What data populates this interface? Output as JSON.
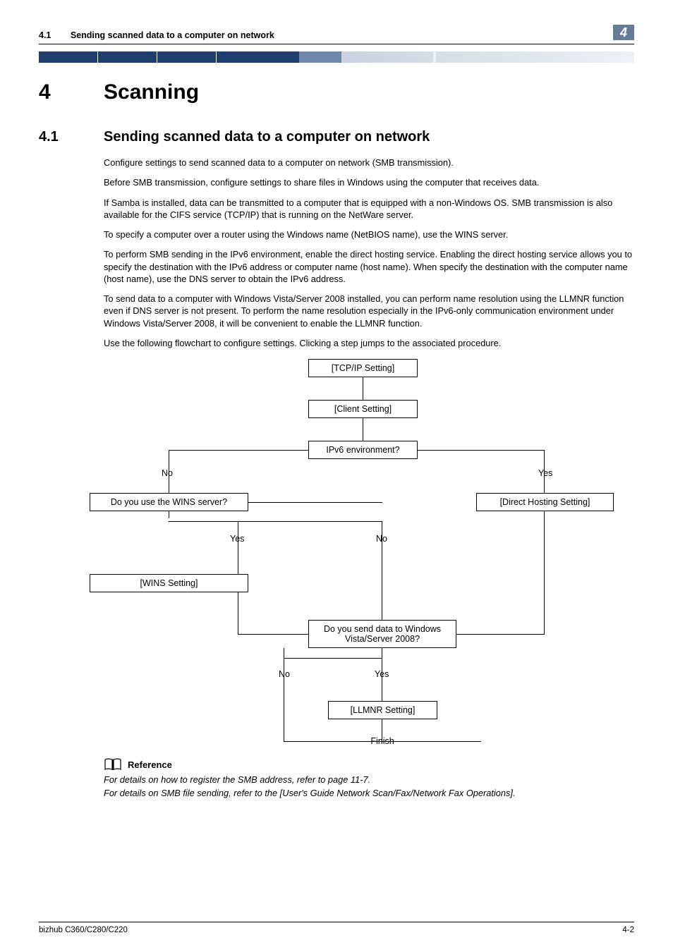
{
  "header": {
    "section_num": "4.1",
    "section_title": "Sending scanned data to a computer on network",
    "corner_num": "4"
  },
  "chapter": {
    "num": "4",
    "title": "Scanning"
  },
  "section": {
    "num": "4.1",
    "title": "Sending scanned data to a computer on network"
  },
  "paragraphs": {
    "p1": "Configure settings to send scanned data to a computer on network (SMB transmission).",
    "p2": "Before SMB transmission, configure settings to share files in Windows using the computer that receives data.",
    "p3": "If Samba is installed, data can be transmitted to a computer that is equipped with a non-Windows OS. SMB transmission is also available for the CIFS service (TCP/IP) that is running on the NetWare server.",
    "p4": "To specify a computer over a router using the Windows name (NetBIOS name), use the WINS server.",
    "p5": "To perform SMB sending in the IPv6 environment, enable the direct hosting service. Enabling the direct hosting service allows you to specify the destination with the IPv6 address or computer name (host name). When specify the destination with the computer name (host name), use the DNS server to obtain the IPv6 address.",
    "p6": "To send data to a computer with Windows Vista/Server 2008 installed, you can perform name resolution using the LLMNR function even if DNS server is not present. To perform the name resolution especially in the IPv6-only communication environment under Windows Vista/Server 2008, it will be convenient to enable the LLMNR function.",
    "p7": "Use the following flowchart to configure settings. Clicking a step jumps to the associated procedure."
  },
  "flowchart": {
    "tcpip": "[TCP/IP Setting]",
    "client": "[Client Setting]",
    "ipv6_q": "IPv6 environment?",
    "no1": "No",
    "yes1": "Yes",
    "wins_q": "Do you use the WINS server?",
    "direct": "[Direct Hosting Setting]",
    "yes2": "Yes",
    "no2": "No",
    "wins": "[WINS Setting]",
    "vista_q": "Do you send data to Windows Vista/Server 2008?",
    "no3": "No",
    "yes3": "Yes",
    "llmnr": "[LLMNR Setting]",
    "finish": "Finish"
  },
  "reference": {
    "heading": "Reference",
    "r1": "For details on how to register the SMB address, refer to page 11-7.",
    "r2": "For details on SMB file sending, refer to the [User's Guide Network Scan/Fax/Network Fax Operations]."
  },
  "footer": {
    "left": "bizhub C360/C280/C220",
    "right": "4-2"
  }
}
